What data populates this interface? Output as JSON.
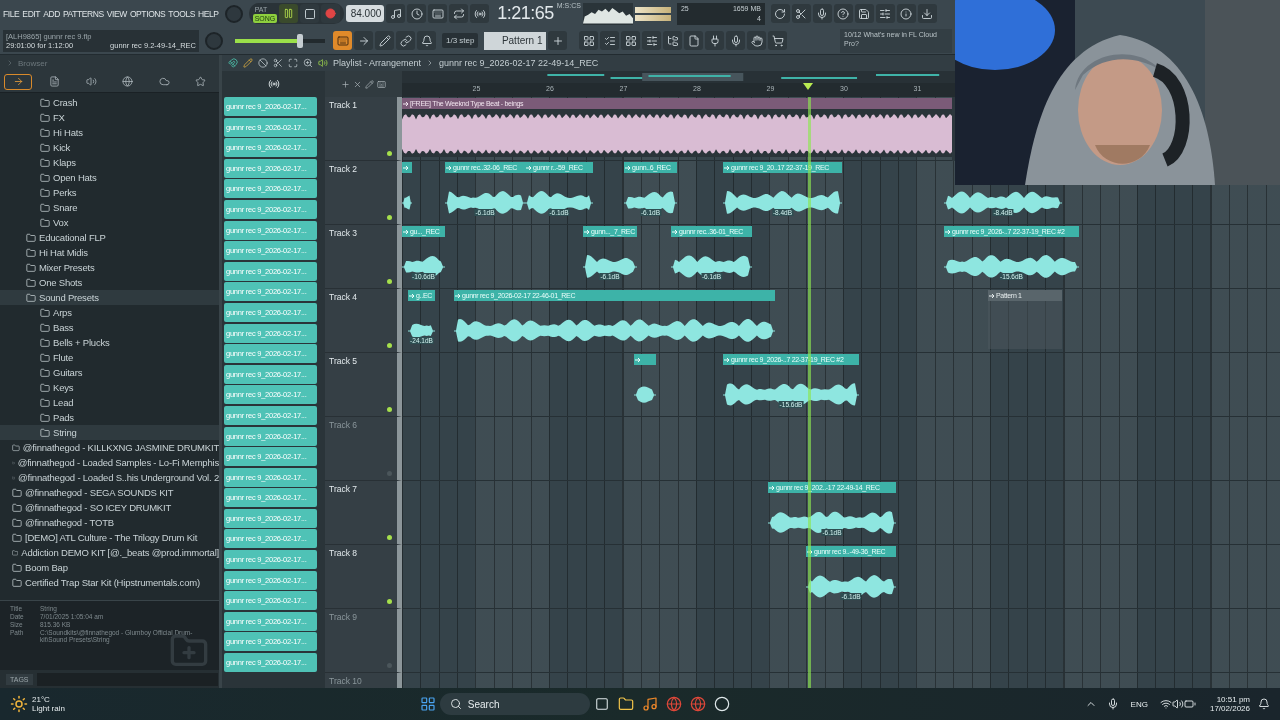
{
  "menu": [
    "FILE",
    "EDIT",
    "ADD",
    "PATTERNS",
    "VIEW",
    "OPTIONS",
    "TOOLS",
    "HELP"
  ],
  "hint": {
    "project": "[ALH9865] gunnr rec 9.flp",
    "position": "29:01:00 for 1:12:00",
    "clip": "gunnr rec 9.2-49-14_REC"
  },
  "transport": {
    "modes": [
      {
        "label": "PAT",
        "selected": false
      },
      {
        "label": "SONG",
        "selected": true
      }
    ],
    "playing": true,
    "tempo": "84.000",
    "time": "1:21:65",
    "time_format": "M:S:CS"
  },
  "master_volume": {
    "level": 0.72
  },
  "monitor": {
    "cpu": "25",
    "memory": "1659 MB",
    "polyphony": "4"
  },
  "snap": "1/3 step",
  "pattern": "Pattern 1",
  "news": {
    "count": "10/12",
    "text": "What's new in FL Cloud Pro?"
  },
  "browser": {
    "title": "Browser",
    "tabs": [
      {
        "selected": true
      },
      {
        "selected": false
      },
      {
        "selected": false
      },
      {
        "selected": false
      },
      {
        "selected": false
      },
      {
        "selected": false
      }
    ],
    "tree": [
      {
        "children": [
          {
            "children": [
              {
                "name": "Crash",
                "selected": false
              },
              {
                "name": "FX",
                "selected": false
              },
              {
                "name": "Hi Hats",
                "selected": false
              },
              {
                "name": "Kick",
                "selected": false
              },
              {
                "name": "Klaps",
                "selected": false
              },
              {
                "name": "Open Hats",
                "selected": false
              },
              {
                "name": "Perks",
                "selected": false
              },
              {
                "name": "Snare",
                "selected": false
              },
              {
                "name": "Vox",
                "selected": false
              }
            ]
          },
          {
            "name": "Educational FLP",
            "selected": false
          },
          {
            "name": "Hi Hat Midis",
            "selected": false
          },
          {
            "name": "Mixer Presets",
            "selected": false
          },
          {
            "name": "One Shots",
            "selected": false
          },
          {
            "name": "Sound Presets",
            "selected": true,
            "children": [
              {
                "name": "Arps",
                "selected": false
              },
              {
                "name": "Bass",
                "selected": false
              },
              {
                "name": "Bells + Plucks",
                "selected": false
              },
              {
                "name": "Flute",
                "selected": false
              },
              {
                "name": "Guitars",
                "selected": false
              },
              {
                "name": "Keys",
                "selected": false
              },
              {
                "name": "Lead",
                "selected": false
              },
              {
                "name": "Pads",
                "selected": false
              },
              {
                "name": "String",
                "selected": true
              }
            ]
          }
        ]
      },
      {
        "name": "@finnathegod - KILLKXNG JASMINE DRUMKIT",
        "selected": false
      },
      {
        "name": "@finnathegod - Loaded Samples - Lo-Fi Memphis",
        "selected": false
      },
      {
        "name": "@finnathegod - Loaded S..his Underground Vol. 2",
        "selected": false
      },
      {
        "name": "@finnathegod - SEGA SOUNDS KIT",
        "selected": false
      },
      {
        "name": "@finnathegod - SO ICEY DRUMKIT",
        "selected": false
      },
      {
        "name": "@finnathegod - TOTB",
        "selected": false
      },
      {
        "name": "[DEMO] ATL Culture - The Trilogy Drum Kit",
        "selected": false
      },
      {
        "name": "Addiction DEMO KIT [@._beats @prod.immortal]",
        "selected": false
      },
      {
        "name": "Boom Bap",
        "selected": false
      },
      {
        "name": "Certified Trap Star Kit (Hipstrumentals.com)",
        "selected": false
      }
    ],
    "info": [
      {
        "label": "Title",
        "value": "String"
      },
      {
        "label": "Date",
        "value": "7/01/2025 1:05:04 am"
      },
      {
        "label": "Size",
        "value": "815.36 KB"
      },
      {
        "label": "Path",
        "value": "C:\\Soundkits\\@finnathegod - Glumboy Official Drum-kit\\Sound Presets\\String"
      }
    ],
    "tags_label": "TAGS"
  },
  "playlist": {
    "title": "Playlist - Arrangement",
    "breadcrumb": "gunnr rec 9_2026-02-17 22-49-14_REC",
    "ruler": [
      "25",
      "26",
      "27",
      "28",
      "29",
      "30",
      "31"
    ],
    "channel_clips": [
      "gunnr rec 9_2026-02-17...",
      "gunnr rec 9_2026-02-17...",
      "gunnr rec 9_2026-02-17...",
      "gunnr rec 9_2026-02-17...",
      "gunnr rec 9_2026-02-17...",
      "gunnr rec 9_2026-02-17...",
      "gunnr rec 9_2026-02-17...",
      "gunnr rec 9_2026-02-17...",
      "gunnr rec 9_2026-02-17...",
      "gunnr rec 9_2026-02-17...",
      "gunnr rec 9_2026-02-17...",
      "gunnr rec 9_2026-02-17...",
      "gunnr rec 9_2026-02-17...",
      "gunnr rec 9_2026-02-17...",
      "gunnr rec 9_2026-02-17...",
      "gunnr rec 9_2026-02-17...",
      "gunnr rec 9_2026-02-17...",
      "gunnr rec 9_2026-02-17...",
      "gunnr rec 9_2026-02-17...",
      "gunnr rec 9_2026-02-17...",
      "gunnr rec 9_2026-02-17...",
      "gunnr rec 9_2026-02-17...",
      "gunnr rec 9_2026-02-17...",
      "gunnr rec 9_2026-02-17...",
      "gunnr rec 9_2026-02-17...",
      "gunnr rec 9_2026-02-17...",
      "gunnr rec 9_2026-02-17...",
      "gunnr rec 9_2026-02-17..."
    ],
    "tracks": [
      {
        "name": "Track 1",
        "empty": false,
        "clips": [
          {
            "kind": "beat",
            "label": "[FREE] The Weeknd Type Beat - beings"
          }
        ]
      },
      {
        "name": "Track 2",
        "empty": false,
        "clips": [
          {
            "kind": "audio"
          },
          {
            "kind": "audio",
            "label": "gunnr rec..32-06_REC",
            "gain": "-6.1dB"
          },
          {
            "kind": "audio",
            "label": "gunnr r..-59_REC",
            "gain": "-6.1dB"
          },
          {
            "kind": "audio",
            "label": "gunn..6_REC",
            "gain": "-6.1dB"
          },
          {
            "kind": "audio",
            "label": "gunnr rec 9_20..17 22-37-19_REC",
            "gain": "-8.4dB"
          },
          {
            "kind": "audio",
            "gain": "-8.4dB"
          }
        ]
      },
      {
        "name": "Track 3",
        "empty": false,
        "clips": [
          {
            "kind": "audio",
            "label": "gu..._REC",
            "gain": "-10.6dB"
          },
          {
            "kind": "audio",
            "label": "gunn..._7_REC",
            "gain": "-6.1dB"
          },
          {
            "kind": "audio",
            "label": "gunnr rec..36-01_REC",
            "gain": "-6.1dB"
          },
          {
            "kind": "audio",
            "label": "gunnr rec 9_2026-..7 22-37-19_REC #2",
            "gain": "-15.6dB"
          }
        ]
      },
      {
        "name": "Track 4",
        "empty": false,
        "clips": [
          {
            "kind": "audio",
            "label": "g..EC",
            "gain": "-24.1dB"
          },
          {
            "kind": "audio",
            "label": "gunnr rec 9_2026-02-17 22-46-01_REC"
          },
          {
            "kind": "pattern",
            "label": "Pattern 1"
          }
        ]
      },
      {
        "name": "Track 5",
        "empty": false,
        "clips": [
          {
            "kind": "audio"
          },
          {
            "kind": "audio",
            "label": "gunnr rec 9_2026-..7 22-37-19_REC #2",
            "gain": "-15.6dB"
          }
        ]
      },
      {
        "name": "Track 6",
        "empty": true
      },
      {
        "name": "Track 7",
        "empty": false,
        "clips": [
          {
            "kind": "audio",
            "label": "gunnr rec 9_202..-17 22-49-14_REC",
            "gain": "-6.1dB"
          }
        ]
      },
      {
        "name": "Track 8",
        "empty": false,
        "clips": [
          {
            "kind": "audio",
            "label": "gunnr rec 9..-49-36_REC",
            "gain": "-6.1dB"
          }
        ]
      },
      {
        "name": "Track 9",
        "empty": true
      },
      {
        "name": "Track 10",
        "empty": true
      }
    ]
  },
  "webcam": {
    "kind": "picture"
  },
  "taskbar": {
    "temperature": "21°C",
    "condition": "Light rain",
    "search": "Search",
    "language": "ENG",
    "time": "10:51 pm",
    "date": "17/02/2026"
  }
}
